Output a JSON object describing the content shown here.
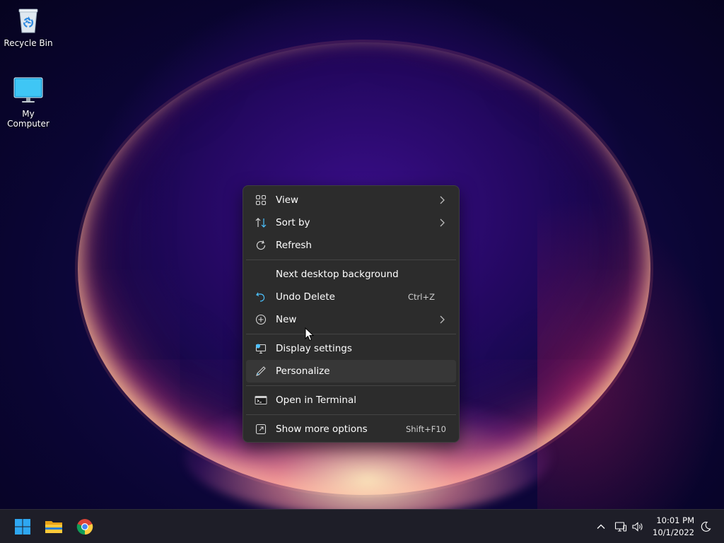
{
  "desktop": {
    "icons": [
      {
        "label": "Recycle Bin",
        "icon": "recycle-bin-icon"
      },
      {
        "label": "My Computer",
        "icon": "monitor-icon"
      }
    ]
  },
  "context_menu": {
    "groups": [
      [
        {
          "label": "View",
          "icon": "grid-icon",
          "submenu": true
        },
        {
          "label": "Sort by",
          "icon": "sort-arrows-icon",
          "submenu": true
        },
        {
          "label": "Refresh",
          "icon": "refresh-icon"
        }
      ],
      [
        {
          "label": "Next desktop background",
          "icon": ""
        },
        {
          "label": "Undo Delete",
          "icon": "undo-icon",
          "shortcut": "Ctrl+Z"
        },
        {
          "label": "New",
          "icon": "plus-circle-icon",
          "submenu": true
        }
      ],
      [
        {
          "label": "Display settings",
          "icon": "display-settings-icon"
        },
        {
          "label": "Personalize",
          "icon": "pen-icon",
          "hovered": true
        }
      ],
      [
        {
          "label": "Open in Terminal",
          "icon": "terminal-icon"
        }
      ],
      [
        {
          "label": "Show more options",
          "icon": "share-external-icon",
          "shortcut": "Shift+F10"
        }
      ]
    ]
  },
  "taskbar": {
    "pinned": [
      {
        "name": "Start",
        "icon": "windows-logo-icon"
      },
      {
        "name": "File Explorer",
        "icon": "folder-icon"
      },
      {
        "name": "Google Chrome",
        "icon": "chrome-icon"
      }
    ],
    "tray": {
      "time": "10:01 PM",
      "date": "10/1/2022",
      "icons": [
        "chevron-up-icon",
        "network-icon",
        "volume-icon",
        "moon-icon"
      ]
    }
  },
  "colors": {
    "menu_bg": "#2c2c2c",
    "menu_hover": "#373737",
    "taskbar_bg": "#1e1e28",
    "accent_blue": "#4cc2ff"
  }
}
